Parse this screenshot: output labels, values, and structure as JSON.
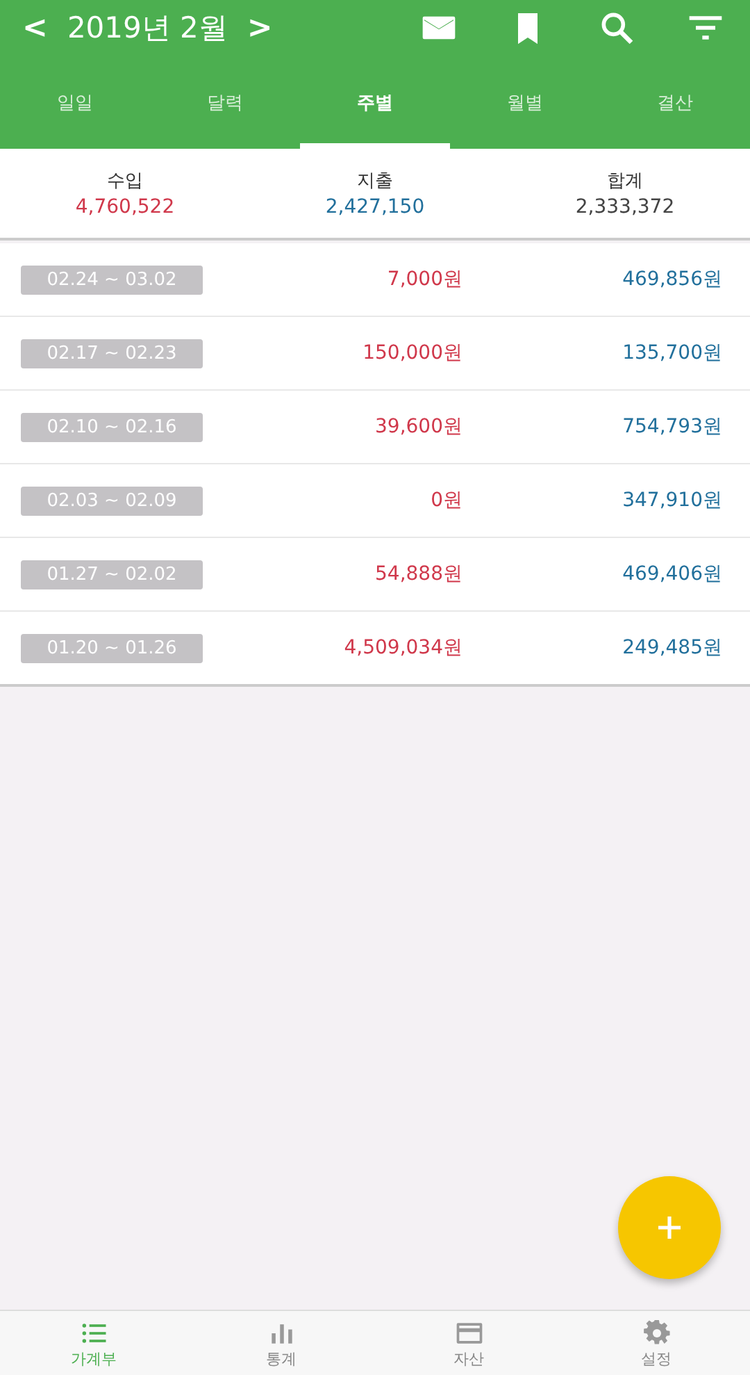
{
  "header": {
    "prev": "<",
    "title": "2019년 2월",
    "next": ">"
  },
  "tabs": [
    {
      "label": "일일",
      "selected": false
    },
    {
      "label": "달력",
      "selected": false
    },
    {
      "label": "주별",
      "selected": true
    },
    {
      "label": "월별",
      "selected": false
    },
    {
      "label": "결산",
      "selected": false
    }
  ],
  "summary": [
    {
      "label": "수입",
      "value": "4,760,522",
      "kind": "income"
    },
    {
      "label": "지출",
      "value": "2,427,150",
      "kind": "expense"
    },
    {
      "label": "합계",
      "value": "2,333,372",
      "kind": "total"
    }
  ],
  "weeks": [
    {
      "range": "02.24 ~ 03.02",
      "income": "7,000원",
      "expense": "469,856원"
    },
    {
      "range": "02.17 ~ 02.23",
      "income": "150,000원",
      "expense": "135,700원"
    },
    {
      "range": "02.10 ~ 02.16",
      "income": "39,600원",
      "expense": "754,793원"
    },
    {
      "range": "02.03 ~ 02.09",
      "income": "0원",
      "expense": "347,910원"
    },
    {
      "range": "01.27 ~ 02.02",
      "income": "54,888원",
      "expense": "469,406원"
    },
    {
      "range": "01.20 ~ 01.26",
      "income": "4,509,034원",
      "expense": "249,485원"
    }
  ],
  "bottom_nav": [
    {
      "label": "가계부",
      "kind": "list",
      "selected": true
    },
    {
      "label": "통계",
      "kind": "chart",
      "selected": false
    },
    {
      "label": "자산",
      "kind": "card",
      "selected": false
    },
    {
      "label": "설정",
      "kind": "gear",
      "selected": false
    }
  ]
}
